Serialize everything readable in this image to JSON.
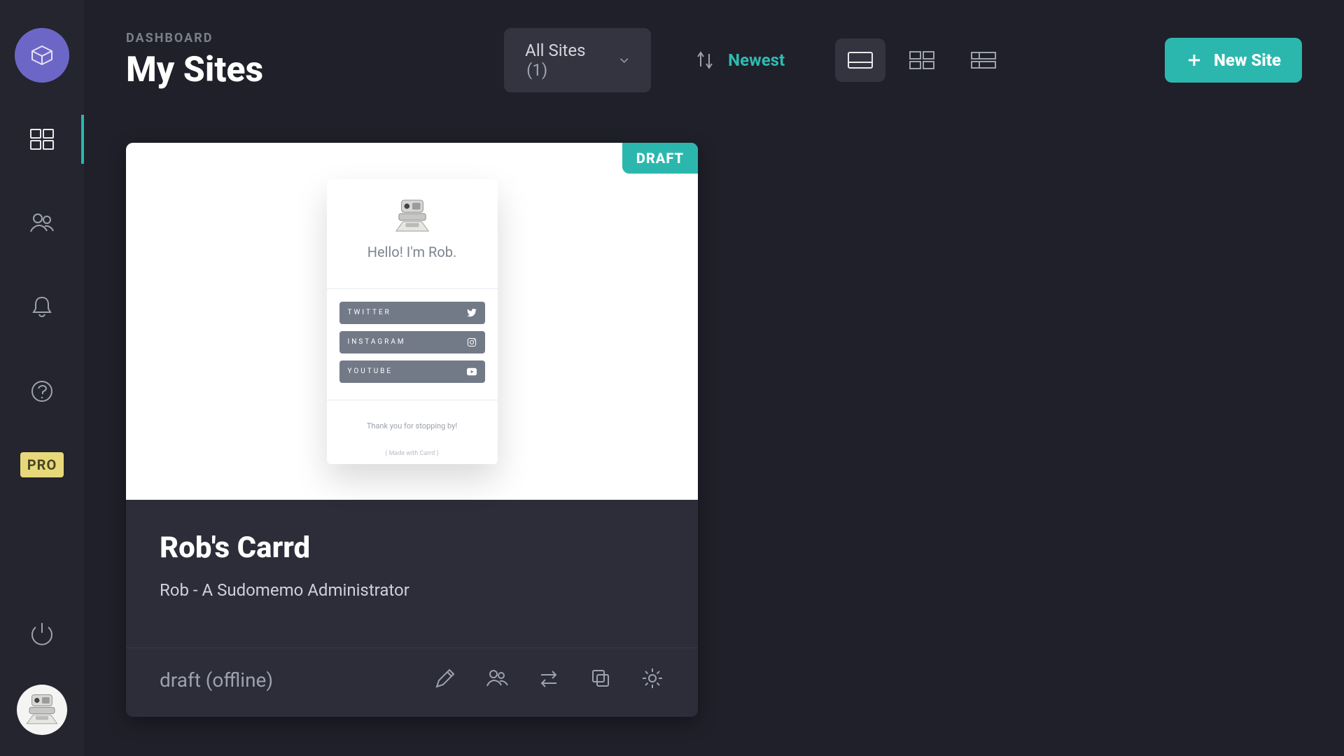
{
  "colors": {
    "accent": "#2cb7ae",
    "bg": "#1f2029",
    "panel": "#24252f"
  },
  "rail": {
    "icons": {
      "dashboard": "dashboard-icon",
      "team": "team-icon",
      "notifications": "bell-icon",
      "help": "help-icon",
      "power": "power-icon"
    },
    "pro_label": "PRO"
  },
  "header": {
    "breadcrumb": "DASHBOARD",
    "title": "My Sites",
    "filter": {
      "label": "All Sites",
      "count": "(1)"
    },
    "sort": {
      "label": "Newest"
    },
    "new_site": "New Site"
  },
  "sites": [
    {
      "badge": "DRAFT",
      "title": "Rob's Carrd",
      "description": "Rob - A Sudomemo Administrator",
      "status": "draft (offline)",
      "preview": {
        "greeting": "Hello! I'm Rob.",
        "buttons": [
          "TWITTER",
          "INSTAGRAM",
          "YOUTUBE"
        ],
        "footer": "Thank you for stopping by!",
        "madewith": "( Made with Carrd )"
      }
    }
  ]
}
